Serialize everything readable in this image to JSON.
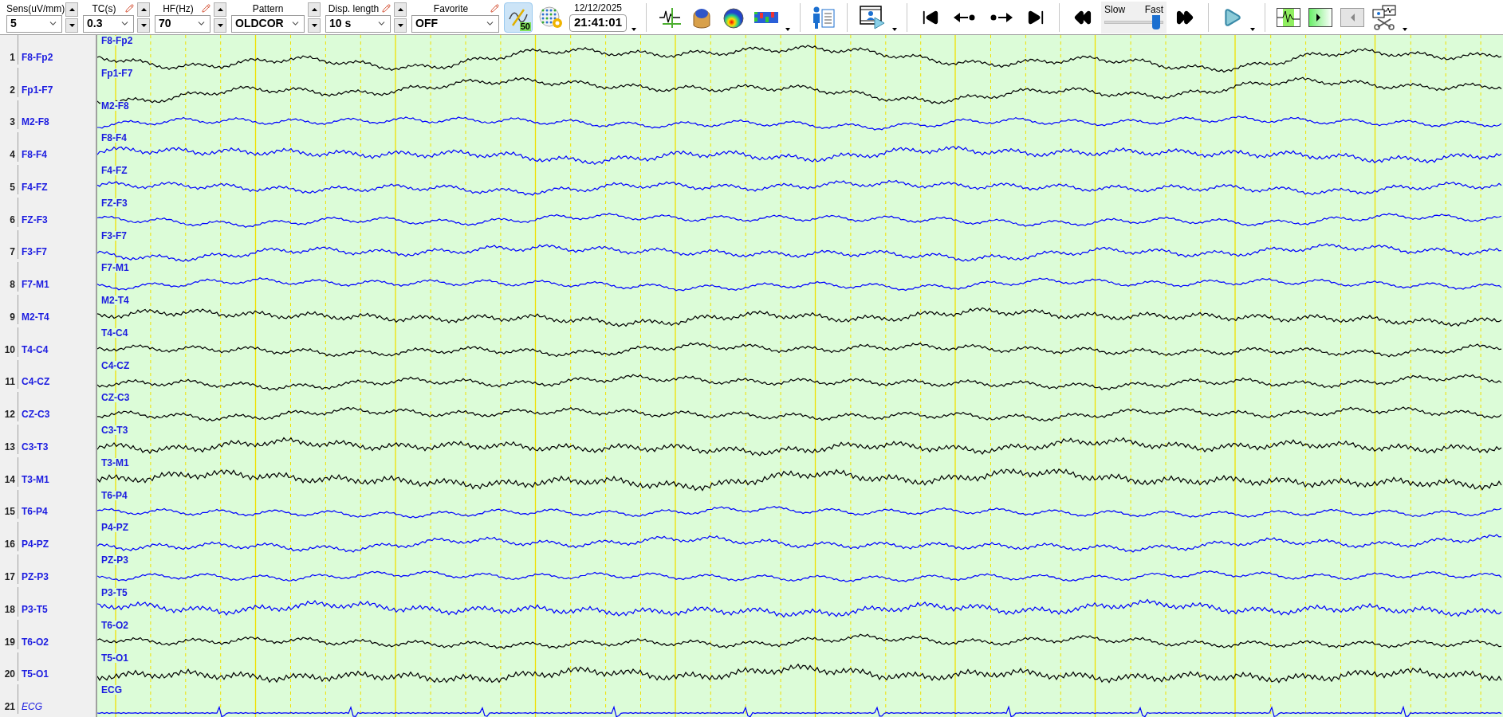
{
  "toolbar": {
    "selectors": [
      {
        "label": "Sens(uV/mm)",
        "value": "5",
        "pencil": false,
        "spinner": true
      },
      {
        "label": "TC(s)",
        "value": "0.3",
        "pencil": true,
        "spinner": true
      },
      {
        "label": "HF(Hz)",
        "value": "70",
        "pencil": true,
        "spinner": true
      },
      {
        "label": "Pattern",
        "value": "OLDCOR",
        "pencil": false,
        "spinner": true
      },
      {
        "label": "Disp. length",
        "value": "10 s",
        "pencil": true,
        "spinner": true
      },
      {
        "label": "Favorite",
        "value": "OFF",
        "pencil": true,
        "spinner": false
      }
    ],
    "filter_badge": "50",
    "filter_selected": true,
    "date": "12/12/2025",
    "time": "21:41:01",
    "speed": {
      "slow_label": "Slow",
      "fast_label": "Fast",
      "level": 0.88
    }
  },
  "channels": [
    {
      "number": "1",
      "name": "F8-Fp2",
      "trace_label": "F8-Fp2",
      "color": "#000000",
      "kind": "eeg"
    },
    {
      "number": "2",
      "name": "Fp1-F7",
      "trace_label": "Fp1-F7",
      "color": "#000000",
      "kind": "eeg"
    },
    {
      "number": "3",
      "name": "M2-F8",
      "trace_label": "M2-F8",
      "color": "#0000ff",
      "kind": "eeg"
    },
    {
      "number": "4",
      "name": "F8-F4",
      "trace_label": "F8-F4",
      "color": "#0000ff",
      "kind": "eeg"
    },
    {
      "number": "5",
      "name": "F4-FZ",
      "trace_label": "F4-FZ",
      "color": "#0000ff",
      "kind": "eeg"
    },
    {
      "number": "6",
      "name": "FZ-F3",
      "trace_label": "FZ-F3",
      "color": "#0000ff",
      "kind": "eeg"
    },
    {
      "number": "7",
      "name": "F3-F7",
      "trace_label": "F3-F7",
      "color": "#0000ff",
      "kind": "eeg"
    },
    {
      "number": "8",
      "name": "F7-M1",
      "trace_label": "F7-M1",
      "color": "#0000ff",
      "kind": "eeg"
    },
    {
      "number": "9",
      "name": "M2-T4",
      "trace_label": "M2-T4",
      "color": "#000000",
      "kind": "eeg"
    },
    {
      "number": "10",
      "name": "T4-C4",
      "trace_label": "T4-C4",
      "color": "#000000",
      "kind": "eeg"
    },
    {
      "number": "11",
      "name": "C4-CZ",
      "trace_label": "C4-CZ",
      "color": "#000000",
      "kind": "eeg"
    },
    {
      "number": "12",
      "name": "CZ-C3",
      "trace_label": "CZ-C3",
      "color": "#000000",
      "kind": "eeg"
    },
    {
      "number": "13",
      "name": "C3-T3",
      "trace_label": "C3-T3",
      "color": "#000000",
      "kind": "eeg"
    },
    {
      "number": "14",
      "name": "T3-M1",
      "trace_label": "T3-M1",
      "color": "#000000",
      "kind": "eeg"
    },
    {
      "number": "15",
      "name": "T6-P4",
      "trace_label": "T6-P4",
      "color": "#0000ff",
      "kind": "eeg"
    },
    {
      "number": "16",
      "name": "P4-PZ",
      "trace_label": "P4-PZ",
      "color": "#0000ff",
      "kind": "eeg"
    },
    {
      "number": "17",
      "name": "PZ-P3",
      "trace_label": "PZ-P3",
      "color": "#0000ff",
      "kind": "eeg"
    },
    {
      "number": "18",
      "name": "P3-T5",
      "trace_label": "P3-T5",
      "color": "#0000ff",
      "kind": "eeg"
    },
    {
      "number": "19",
      "name": "T6-O2",
      "trace_label": "T6-O2",
      "color": "#000000",
      "kind": "eeg"
    },
    {
      "number": "20",
      "name": "T5-O1",
      "trace_label": "T5-O1",
      "color": "#000000",
      "kind": "eeg"
    },
    {
      "number": "21",
      "name": "ECG",
      "trace_label": "ECG",
      "color": "#0000ff",
      "kind": "ecg"
    }
  ]
}
